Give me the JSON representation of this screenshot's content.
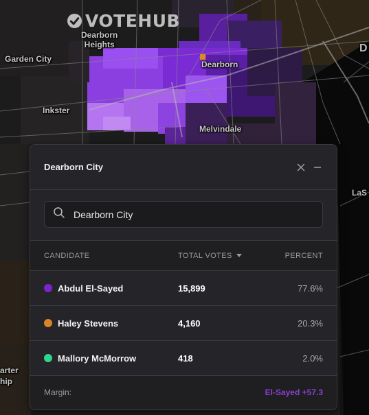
{
  "brand": {
    "name": "VOTEHUB"
  },
  "map": {
    "labels": {
      "dearborn_heights": "Dearborn\nHeights",
      "garden_city": "Garden City",
      "dearborn": "Dearborn",
      "inkster": "Inkster",
      "melvindale": "Melvindale",
      "lasalle_partial": "LaS",
      "d_partial": "D",
      "arter_partial": "arter",
      "hip_partial": "hip"
    },
    "colors": {
      "water": "#080808",
      "land": "#1e1d1d",
      "winner": "#7a2bd3",
      "light_winner": "#b574f0"
    }
  },
  "panel": {
    "title": "Dearborn City",
    "search": {
      "value": "Dearborn City",
      "placeholder": "Search"
    },
    "columns": {
      "candidate": "CANDIDATE",
      "votes": "TOTAL VOTES",
      "percent": "PERCENT"
    },
    "rows": [
      {
        "name": "Abdul El-Sayed",
        "votes": "15,899",
        "percent": "77.6%",
        "color": "#7b24c9"
      },
      {
        "name": "Haley Stevens",
        "votes": "4,160",
        "percent": "20.3%",
        "color": "#d9842b"
      },
      {
        "name": "Mallory McMorrow",
        "votes": "418",
        "percent": "2.0%",
        "color": "#2fd48e"
      }
    ],
    "margin": {
      "label": "Margin:",
      "value": "El-Sayed +57.3"
    },
    "icons": {
      "close": "close-icon",
      "minimize": "minimize-icon",
      "search": "search-icon"
    }
  }
}
